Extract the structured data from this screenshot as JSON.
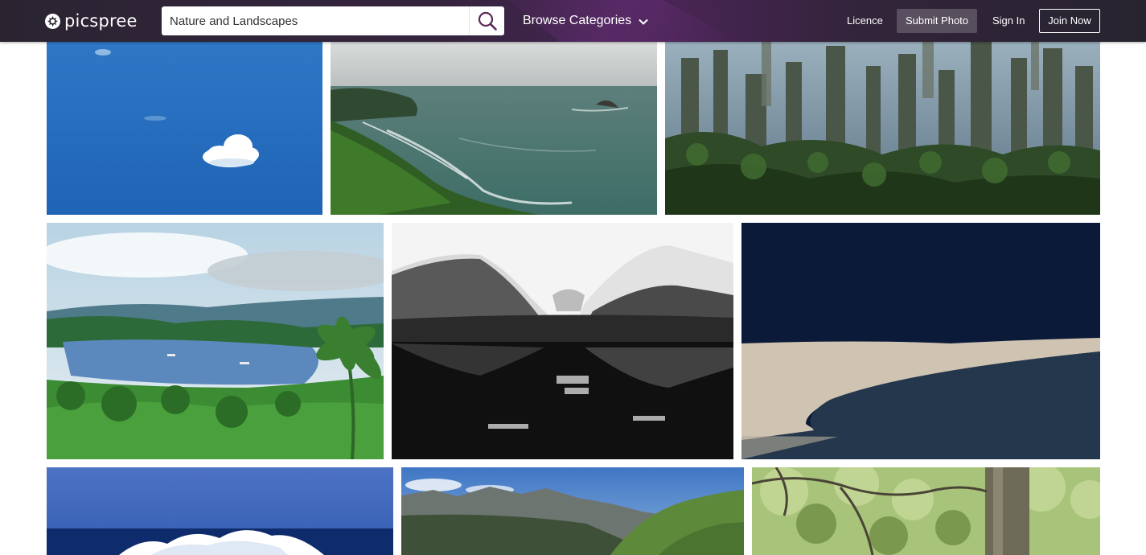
{
  "header": {
    "logo_text": "picspree",
    "search": {
      "value": "Nature and Landscapes",
      "placeholder": ""
    },
    "browse_label": "Browse Categories",
    "nav": {
      "licence": "Licence",
      "submit_photo": "Submit Photo",
      "sign_in": "Sign In",
      "join_now": "Join Now"
    }
  },
  "icons": {
    "logo": "aperture-icon",
    "search": "search-icon",
    "browse": "chevron-down-icon"
  },
  "colors": {
    "header_bg": "#2d2533",
    "header_accent": "#4a2556",
    "search_icon": "#5a2a55",
    "text_light": "#ffffff"
  },
  "photos": [
    {
      "subject": "blue-sky-cloud"
    },
    {
      "subject": "sea-cliff"
    },
    {
      "subject": "karst-forest"
    },
    {
      "subject": "tropical-bay"
    },
    {
      "subject": "mountain-lake-bw"
    },
    {
      "subject": "desert-dune"
    },
    {
      "subject": "ocean-wave"
    },
    {
      "subject": "alpine-ridge"
    },
    {
      "subject": "forest-tree"
    }
  ]
}
